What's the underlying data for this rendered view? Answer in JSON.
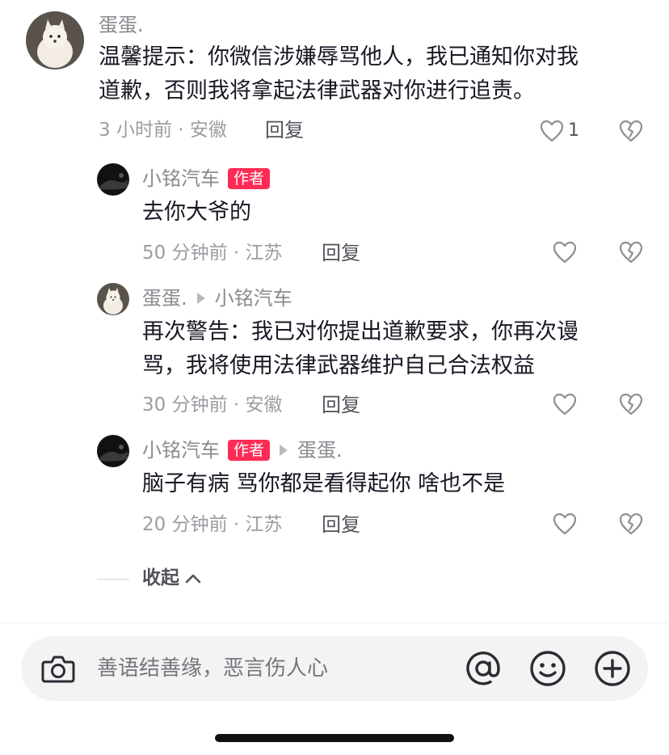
{
  "comments": [
    {
      "name": "蛋蛋.",
      "text_line1": "温馨提示：你微信涉嫌辱骂他人，我已通知你对我",
      "text_line2": "道歉，否则我将拿起法律武器对你进行追责。",
      "meta": "3 小时前 · 安徽",
      "reply_label": "回复",
      "like_count": "1"
    },
    {
      "name": "小铭汽车",
      "badge": "作者",
      "text": "去你大爷的",
      "meta": "50 分钟前 · 江苏",
      "reply_label": "回复"
    },
    {
      "name": "蛋蛋.",
      "reply_to": "小铭汽车",
      "text_line1": "再次警告：我已对你提出道歉要求，你再次谩",
      "text_line2": "骂，我将使用法律武器维护自己合法权益",
      "meta": "30 分钟前 · 安徽",
      "reply_label": "回复"
    },
    {
      "name": "小铭汽车",
      "badge": "作者",
      "reply_to": "蛋蛋.",
      "text": "脑子有病 骂你都是看得起你 啥也不是",
      "meta": "20 分钟前 · 江苏",
      "reply_label": "回复"
    }
  ],
  "collapse_label": "收起",
  "input": {
    "placeholder": "善语结善缘，恶言伤人心"
  },
  "icons": {
    "camera": "camera-icon",
    "at": "at-icon",
    "emoji": "emoji-icon",
    "plus": "plus-icon",
    "like": "heart-icon",
    "dislike": "broken-heart-icon",
    "collapse": "chevron-up-icon"
  },
  "colors": {
    "badge": "#fe2c55",
    "meta": "#9c9da2",
    "text": "#161823"
  }
}
